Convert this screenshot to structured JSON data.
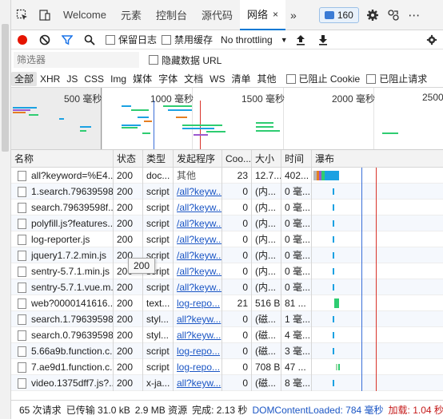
{
  "tabs": {
    "inspect_icon": "inspect-icon",
    "device_icon": "device-icon",
    "items": [
      {
        "label": "Welcome",
        "active": false
      },
      {
        "label": "元素",
        "active": false
      },
      {
        "label": "控制台",
        "active": false
      },
      {
        "label": "源代码",
        "active": false
      },
      {
        "label": "网络",
        "active": true
      }
    ],
    "close": "×",
    "more": "»",
    "badge_count": "160",
    "settings_icon": "gear-icon",
    "connect_icon": "devices-icon",
    "menu_icon": "more-menu-icon"
  },
  "toolbar": {
    "preserve_log": "保留日志",
    "disable_cache": "禁用缓存",
    "throttling": "No throttling",
    "settings_icon": "gear-icon"
  },
  "filter": {
    "placeholder": "筛选器",
    "hide_data_url": "隐藏数据 URL"
  },
  "types": {
    "items": [
      "全部",
      "XHR",
      "JS",
      "CSS",
      "Img",
      "媒体",
      "字体",
      "文档",
      "WS",
      "清单",
      "其他"
    ],
    "active": "全部",
    "blocked_cookie": "已阻止 Cookie",
    "blocked_request": "已阻止请求"
  },
  "overview": {
    "labels": [
      "500 毫秒",
      "1000 毫秒",
      "1500 毫秒",
      "2000 毫秒",
      "2500"
    ]
  },
  "columns": {
    "name": "名称",
    "status": "状态",
    "type": "类型",
    "initiator": "发起程序",
    "cookies": "Coo...",
    "size": "大小",
    "time": "时间",
    "waterfall": "瀑布"
  },
  "rows": [
    {
      "name": "all?keyword=%E4...",
      "status": "200",
      "type": "doc...",
      "initiator": "其他",
      "initiator_link": false,
      "cookies": "23",
      "size": "12.7...",
      "time": "402...",
      "wf": "doc"
    },
    {
      "name": "1.search.79639598...",
      "status": "200",
      "type": "script",
      "initiator": "/all?keyw...",
      "initiator_link": true,
      "cookies": "0",
      "size": "(内...",
      "time": "0 毫...",
      "wf": "cache"
    },
    {
      "name": "search.79639598f...",
      "status": "200",
      "type": "script",
      "initiator": "/all?keyw...",
      "initiator_link": true,
      "cookies": "0",
      "size": "(内...",
      "time": "0 毫...",
      "wf": "cache"
    },
    {
      "name": "polyfill.js?features...",
      "status": "200",
      "type": "script",
      "initiator": "/all?keyw...",
      "initiator_link": true,
      "cookies": "0",
      "size": "(内...",
      "time": "0 毫...",
      "wf": "cache"
    },
    {
      "name": "log-reporter.js",
      "status": "200",
      "type": "script",
      "initiator": "/all?keyw...",
      "initiator_link": true,
      "cookies": "0",
      "size": "(内...",
      "time": "0 毫...",
      "wf": "cache"
    },
    {
      "name": "jquery1.7.2.min.js",
      "status": "200",
      "type": "script",
      "initiator": "/all?keyw...",
      "initiator_link": true,
      "cookies": "0",
      "size": "(内...",
      "time": "0 毫...",
      "wf": "cache"
    },
    {
      "name": "sentry-5.7.1.min.js",
      "status": "200",
      "type": "script",
      "initiator": "/all?keyw...",
      "initiator_link": true,
      "cookies": "0",
      "size": "(内...",
      "time": "0 毫...",
      "wf": "cache"
    },
    {
      "name": "sentry-5.7.1.vue.m...",
      "status": "200",
      "type": "script",
      "initiator": "/all?keyw...",
      "initiator_link": true,
      "cookies": "0",
      "size": "(内...",
      "time": "0 毫...",
      "wf": "cache"
    },
    {
      "name": "web?0000141616...",
      "status": "200",
      "type": "text...",
      "initiator": "log-repo...",
      "initiator_link": true,
      "cookies": "21",
      "size": "516 B",
      "time": "81 ...",
      "wf": "green"
    },
    {
      "name": "search.1.79639598...",
      "status": "200",
      "type": "styl...",
      "initiator": "all?keyw...",
      "initiator_link": true,
      "cookies": "0",
      "size": "(磁...",
      "time": "1 毫...",
      "wf": "cache"
    },
    {
      "name": "search.0.79639598...",
      "status": "200",
      "type": "styl...",
      "initiator": "all?keyw...",
      "initiator_link": true,
      "cookies": "0",
      "size": "(磁...",
      "time": "4 毫...",
      "wf": "cache"
    },
    {
      "name": "5.66a9b.function.c...",
      "status": "200",
      "type": "script",
      "initiator": "log-repo...",
      "initiator_link": true,
      "cookies": "0",
      "size": "(磁...",
      "time": "3 毫...",
      "wf": "cache"
    },
    {
      "name": "7.ae9d1.function.c...",
      "status": "200",
      "type": "script",
      "initiator": "log-repo...",
      "initiator_link": true,
      "cookies": "0",
      "size": "708 B",
      "time": "47 ...",
      "wf": "small"
    },
    {
      "name": "video.1375dff7.js?...",
      "status": "200",
      "type": "x-ja...",
      "initiator": "all?keyw...",
      "initiator_link": true,
      "cookies": "0",
      "size": "(磁...",
      "time": "8 毫...",
      "wf": "cache"
    }
  ],
  "tooltip": "200",
  "status": {
    "requests": "65 次请求",
    "transferred": "已传输 31.0 kB",
    "resources": "2.9 MB 资源",
    "finish": "完成: 2.13 秒",
    "dcl": "DOMContentLoaded: 784 毫秒",
    "load": "加载: 1.04 秒"
  }
}
